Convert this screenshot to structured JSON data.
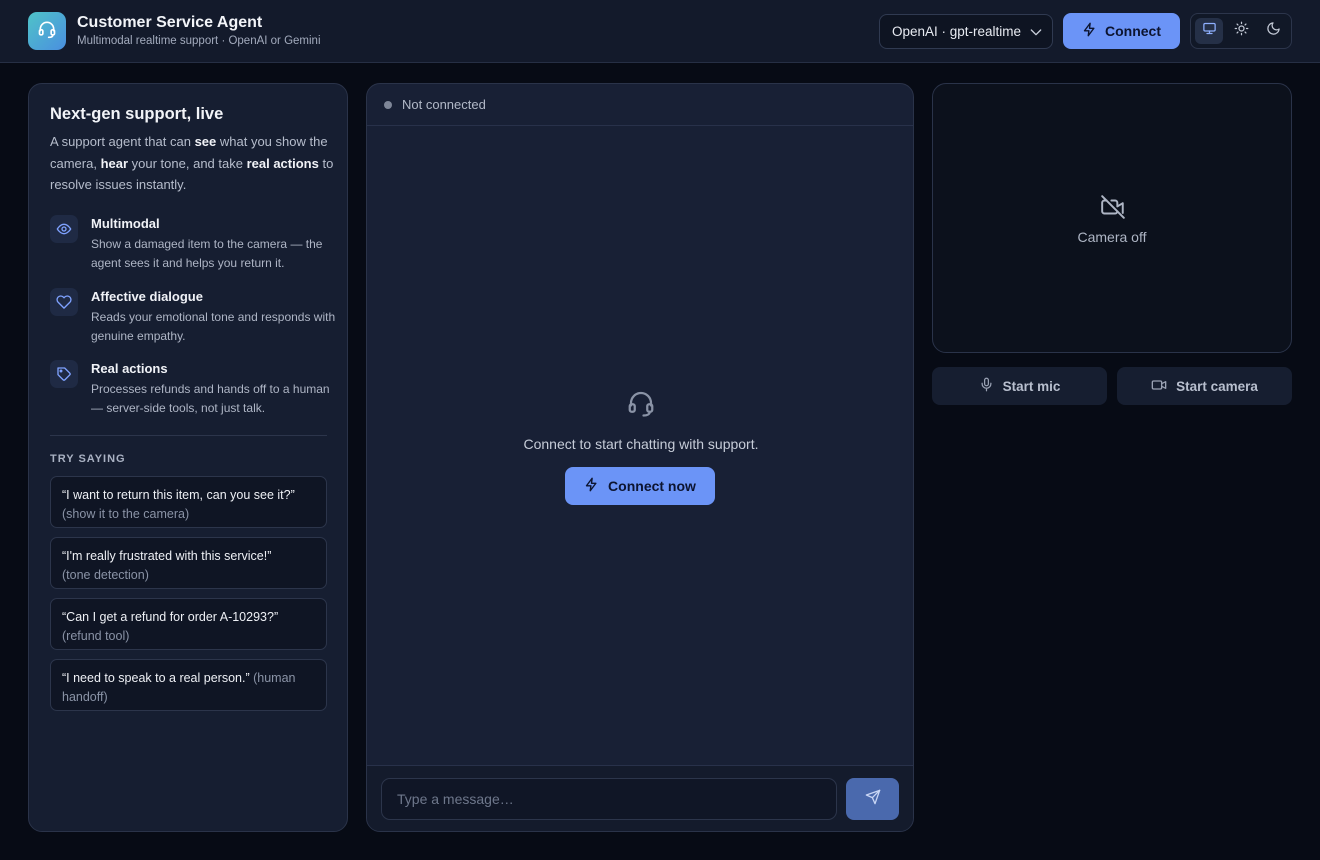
{
  "header": {
    "title": "Customer Service Agent",
    "subtitle": "Multimodal realtime support · OpenAI or Gemini",
    "model_select": {
      "value": "OpenAI · gpt-realtime"
    },
    "connect_label": "Connect",
    "theme_options": [
      "system-monitor-icon",
      "sun-icon",
      "moon-icon"
    ],
    "active_theme": "system"
  },
  "left_panel": {
    "title": "Next-gen support, live",
    "intro": {
      "p1": "A support agent that can ",
      "b1": "see",
      "p2": " what you show the camera, ",
      "b2": "hear",
      "p3": " your tone, and take ",
      "b3": "real actions",
      "p4": " to resolve issues instantly."
    },
    "features": [
      {
        "icon": "eye-icon",
        "name": "Multimodal",
        "desc": "Show a damaged item to the camera — the agent sees it and helps you return it."
      },
      {
        "icon": "heart-icon",
        "name": "Affective dialogue",
        "desc": "Reads your emotional tone and responds with genuine empathy."
      },
      {
        "icon": "tag-icon",
        "name": "Real actions",
        "desc": "Processes refunds and hands off to a human — server-side tools, not just talk."
      }
    ],
    "try_label": "TRY SAYING",
    "try_prompts": [
      {
        "quote": "“I want to return this item, can you see it?”",
        "hint": "(show it to the camera)"
      },
      {
        "quote": "“I'm really frustrated with this service!”",
        "hint": "(tone detection)"
      },
      {
        "quote": "“Can I get a refund for order A-10293?”",
        "hint": "(refund tool)"
      },
      {
        "quote": "“I need to speak to a real person.”",
        "hint": "(human handoff)"
      }
    ]
  },
  "chat": {
    "status": "Not connected",
    "empty_text": "Connect to start chatting with support.",
    "connect_now_label": "Connect now",
    "input_value": "",
    "input_placeholder": "Type a message…"
  },
  "camera": {
    "status": "Camera off",
    "start_mic_label": "Start mic",
    "start_camera_label": "Start camera"
  },
  "colors": {
    "accent": "#6b94f7",
    "background": "#070b15",
    "panel": "#161e31"
  }
}
